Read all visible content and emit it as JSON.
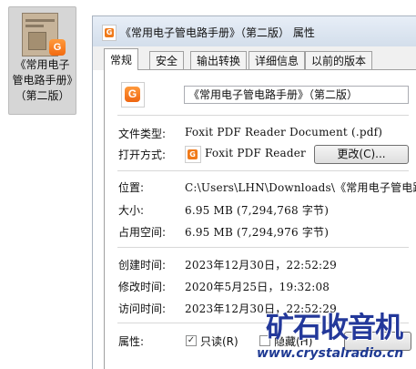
{
  "desktop_file": {
    "name": "《常用电子管电路手册》（第二版）",
    "thumbnail_icon": "pdf-document-thumbnail",
    "badge_icon": "foxit-badge-icon"
  },
  "dialog": {
    "title": "《常用电子管电路手册》（第二版） 属性",
    "title_icon": "foxit-pdf-icon",
    "tabs": [
      {
        "label": "常规",
        "active": true
      },
      {
        "label": "安全",
        "active": false
      },
      {
        "label": "输出转换",
        "active": false
      },
      {
        "label": "详细信息",
        "active": false
      },
      {
        "label": "以前的版本",
        "active": false
      }
    ],
    "general": {
      "file_icon": "foxit-pdf-icon",
      "file_name": "《常用电子管电路手册》（第二版）",
      "type_label": "文件类型:",
      "type_value": "Foxit PDF Reader Document (.pdf)",
      "open_with_label": "打开方式:",
      "open_with_value": "Foxit PDF Reader",
      "open_with_icon": "foxit-app-icon",
      "change_button": "更改(C)...",
      "location_label": "位置:",
      "location_value": "C:\\Users\\LHN\\Downloads\\《常用电子管电路手",
      "size_label": "大小:",
      "size_value": "6.95 MB (7,294,768 字节)",
      "disk_size_label": "占用空间:",
      "disk_size_value": "6.95 MB (7,294,976 字节)",
      "created_label": "创建时间:",
      "created_value": "2023年12月30日，22:52:29",
      "modified_label": "修改时间:",
      "modified_value": "2020年5月25日，19:32:08",
      "accessed_label": "访问时间:",
      "accessed_value": "2023年12月30日，22:52:29",
      "attributes_label": "属性:",
      "readonly_label": "只读(R)",
      "readonly_checked": true,
      "hidden_label": "隐藏(H)",
      "hidden_checked": false
    }
  },
  "watermark": {
    "text_cn": "矿石收音机",
    "url": "www.crystalradio.cn",
    "color": "#23389a"
  }
}
